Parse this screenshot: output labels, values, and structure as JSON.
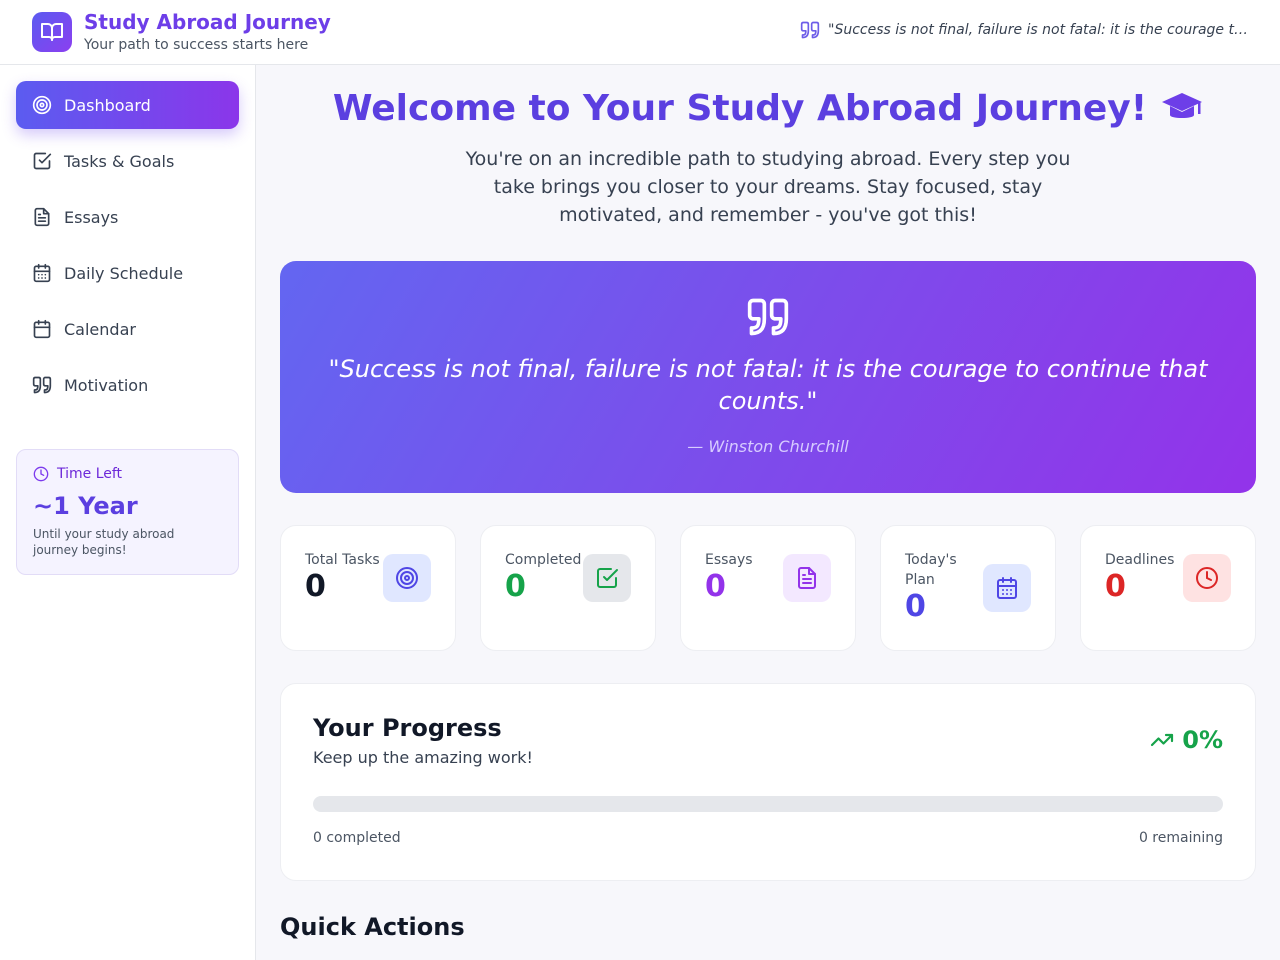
{
  "header": {
    "title": "Study Abroad Journey",
    "subtitle": "Your path to success starts here",
    "quote": "\"Success is not final, failure is not fatal: it is the courage to continue that counts.\""
  },
  "sidebar": {
    "items": [
      {
        "label": "Dashboard",
        "icon": "target-icon",
        "active": true
      },
      {
        "label": "Tasks & Goals",
        "icon": "checkbox-icon"
      },
      {
        "label": "Essays",
        "icon": "document-icon"
      },
      {
        "label": "Daily Schedule",
        "icon": "calendar-grid-icon"
      },
      {
        "label": "Calendar",
        "icon": "calendar-icon"
      },
      {
        "label": "Motivation",
        "icon": "quote-icon"
      }
    ],
    "time_card": {
      "label": "Time Left",
      "value": "~1 Year",
      "note": "Until your study abroad journey begins!"
    }
  },
  "main": {
    "welcome_title": "Welcome to Your Study Abroad Journey!",
    "welcome_text": "You're on an incredible path to studying abroad. Every step you take brings you closer to your dreams. Stay focused, stay motivated, and remember - you've got this!",
    "quote": {
      "text": "\"Success is not final, failure is not fatal: it is the courage to continue that counts.\"",
      "author": "— Winston Churchill"
    },
    "stats": [
      {
        "label": "Total Tasks",
        "value": "0",
        "color": "#111827",
        "icon": "target-icon",
        "icon_bg": "#e0e7ff",
        "icon_color": "#4f46e5"
      },
      {
        "label": "Completed",
        "value": "0",
        "color": "#16a34a",
        "icon": "check-square-icon",
        "icon_bg": "#e5e7eb",
        "icon_color": "#16a34a"
      },
      {
        "label": "Essays",
        "value": "0",
        "color": "#9333ea",
        "icon": "document-icon",
        "icon_bg": "#f3e8ff",
        "icon_color": "#9333ea"
      },
      {
        "label": "Today's Plan",
        "value": "0",
        "color": "#4f46e5",
        "icon": "calendar-grid-icon",
        "icon_bg": "#e0e7ff",
        "icon_color": "#4f46e5"
      },
      {
        "label": "Deadlines",
        "value": "0",
        "color": "#dc2626",
        "icon": "clock-icon",
        "icon_bg": "#fee2e2",
        "icon_color": "#dc2626"
      }
    ],
    "progress": {
      "title": "Your Progress",
      "subtitle": "Keep up the amazing work!",
      "percent_label": "0%",
      "percent": 0,
      "completed_label": "0 completed",
      "remaining_label": "0 remaining"
    },
    "quick_actions_title": "Quick Actions"
  },
  "colors": {
    "accent": "#6d3ee8",
    "gradient_start": "#6366f1",
    "gradient_end": "#9333ea"
  }
}
